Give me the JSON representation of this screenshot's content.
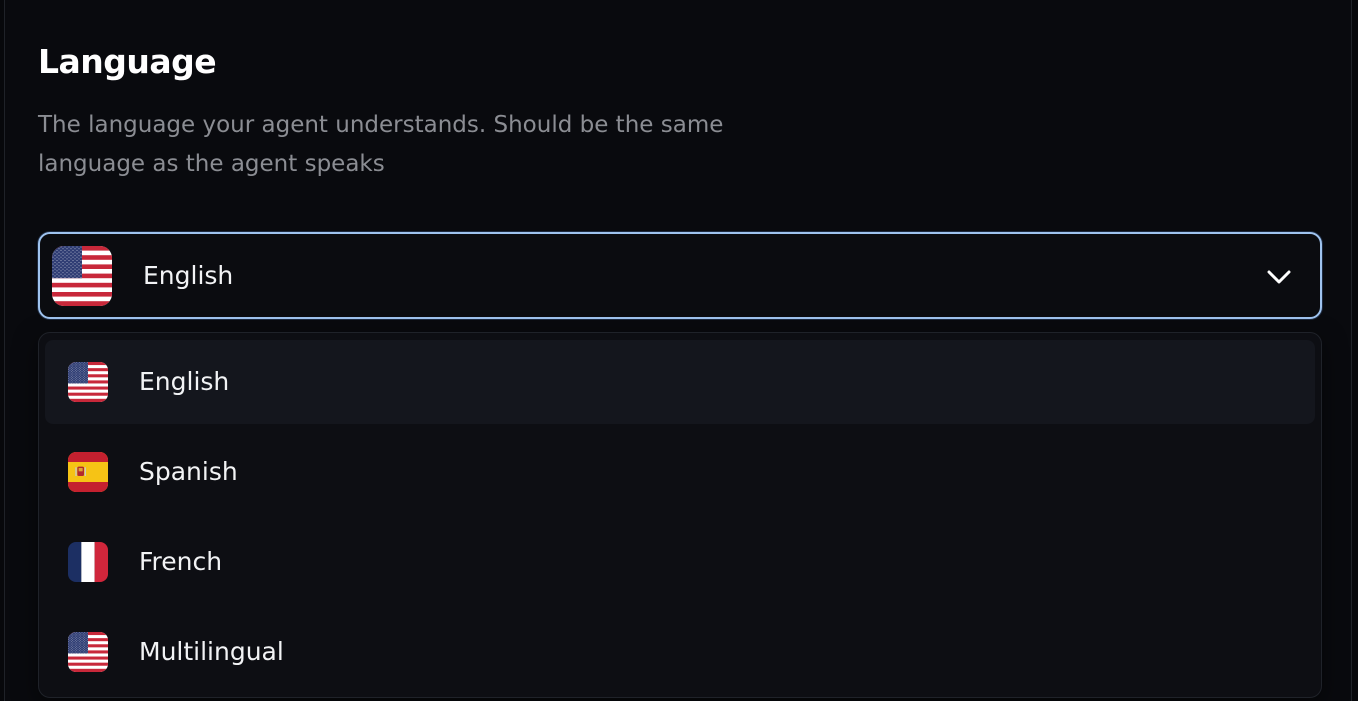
{
  "section": {
    "title": "Language",
    "description": "The language your agent understands. Should be the same language as the agent speaks"
  },
  "select": {
    "selected_label": "English",
    "selected_flag": "us-flag-icon",
    "focus_border_color": "#9fc3ef"
  },
  "options": [
    {
      "label": "English",
      "flag": "us-flag-icon",
      "highlighted": true
    },
    {
      "label": "Spanish",
      "flag": "spain-flag-icon",
      "highlighted": false
    },
    {
      "label": "French",
      "flag": "france-flag-icon",
      "highlighted": false
    },
    {
      "label": "Multilingual",
      "flag": "us-flag-icon",
      "highlighted": false
    }
  ]
}
